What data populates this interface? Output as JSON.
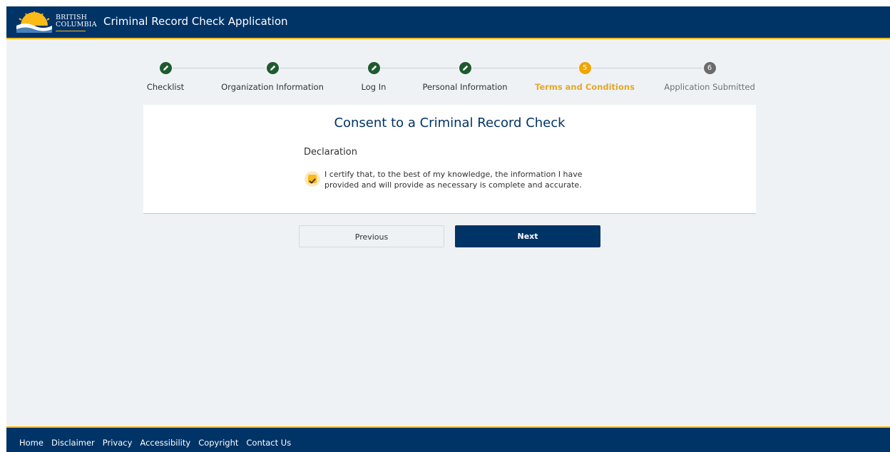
{
  "header": {
    "logo_line1": "BRITISH",
    "logo_line2": "COLUMBIA",
    "title": "Criminal Record Check Application"
  },
  "stepper": {
    "steps": [
      {
        "label": "Checklist",
        "status": "done",
        "icon": "pencil-icon"
      },
      {
        "label": "Organization Information",
        "status": "done",
        "icon": "pencil-icon"
      },
      {
        "label": "Log In",
        "status": "done",
        "icon": "pencil-icon"
      },
      {
        "label": "Personal Information",
        "status": "done",
        "icon": "pencil-icon"
      },
      {
        "label": "Terms and Conditions",
        "status": "current",
        "number": "5"
      },
      {
        "label": "Application Submitted",
        "status": "pending",
        "number": "6"
      }
    ]
  },
  "consent": {
    "title": "Consent to a Criminal Record Check",
    "declaration_heading": "Declaration",
    "declaration_text": "I certify that, to the best of my knowledge, the information I have provided and will provide as necessary is complete and accurate.",
    "checked": true
  },
  "buttons": {
    "previous": "Previous",
    "next": "Next"
  },
  "footer": {
    "links": [
      "Home",
      "Disclaimer",
      "Privacy",
      "Accessibility",
      "Copyright",
      "Contact Us"
    ]
  },
  "colors": {
    "brand_blue": "#003366",
    "brand_gold": "#fcba19",
    "done_green": "#1e5a2e"
  }
}
